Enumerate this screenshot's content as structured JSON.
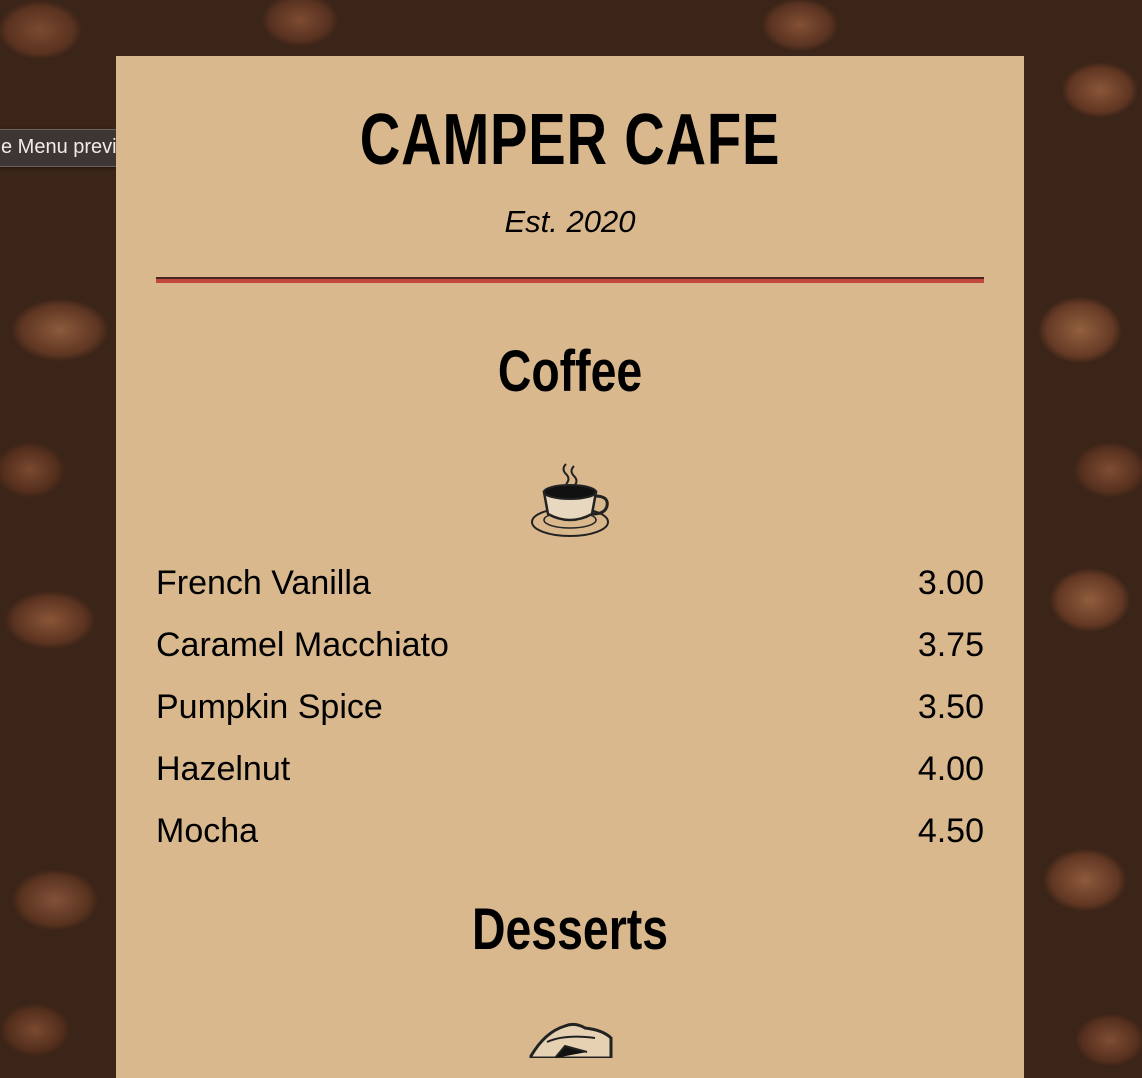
{
  "tooltip": {
    "text": "e Menu preview"
  },
  "menu": {
    "title": "CAMPER CAFE",
    "established": "Est. 2020",
    "sections": [
      {
        "title": "Coffee",
        "icon": "coffee-cup-icon",
        "items": [
          {
            "name": "French Vanilla",
            "price": "3.00"
          },
          {
            "name": "Caramel Macchiato",
            "price": "3.75"
          },
          {
            "name": "Pumpkin Spice",
            "price": "3.50"
          },
          {
            "name": "Hazelnut",
            "price": "4.00"
          },
          {
            "name": "Mocha",
            "price": "4.50"
          }
        ]
      },
      {
        "title": "Desserts",
        "icon": "pie-slice-icon"
      }
    ]
  },
  "colors": {
    "menu_background": "#d9b88e",
    "divider": "#c2473c",
    "tooltip_background": "#3d3634"
  }
}
